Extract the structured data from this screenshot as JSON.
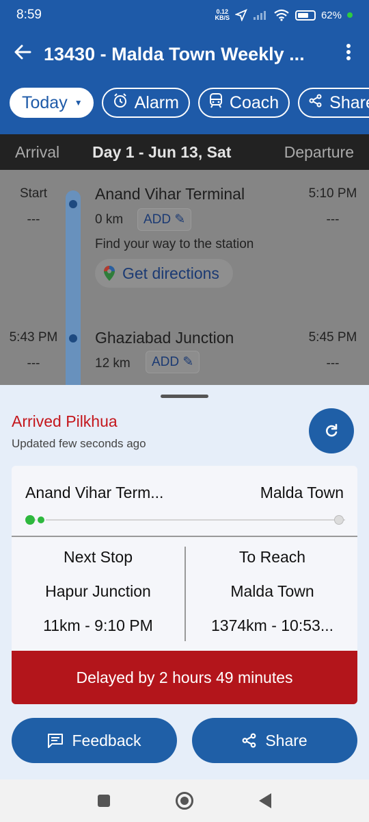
{
  "status_bar": {
    "time": "8:59",
    "net_speed_top": "0.12",
    "net_speed_bottom": "KB/S",
    "battery": "62%"
  },
  "appbar": {
    "title": "13430 - Malda Town Weekly ..."
  },
  "chips": {
    "today": "Today",
    "alarm": "Alarm",
    "coach": "Coach",
    "share": "Share"
  },
  "day_header": {
    "arrival": "Arrival",
    "day": "Day 1 - Jun 13, Sat",
    "departure": "Departure"
  },
  "stops": [
    {
      "arr_time": "Start",
      "arr_delay": "---",
      "name": "Anand Vihar Terminal",
      "km": "0 km",
      "add": "ADD",
      "dep_time": "5:10 PM",
      "dep_delay": "---",
      "find_way": "Find your way to the station",
      "directions": "Get directions"
    },
    {
      "arr_time": "5:43 PM",
      "arr_delay": "---",
      "name": "Ghaziabad Junction",
      "km": "12 km",
      "add": "ADD",
      "dep_time": "5:45 PM",
      "dep_delay": "---"
    }
  ],
  "sheet": {
    "status": "Arrived Pilkhua",
    "updated": "Updated few seconds ago",
    "from": "Anand Vihar Term...",
    "to": "Malda Town",
    "progress": 0.04,
    "next_stop": {
      "heading": "Next Stop",
      "station": "Hapur Junction",
      "info": "11km - 9:10 PM"
    },
    "to_reach": {
      "heading": "To Reach",
      "station": "Malda Town",
      "info": "1374km - 10:53..."
    },
    "delay": "Delayed by 2 hours 49 minutes",
    "feedback": "Feedback",
    "share": "Share"
  },
  "colors": {
    "primary": "#1e5aa8",
    "delay_red": "#b3151b",
    "status_red": "#c4161c",
    "progress_green": "#2eb83e"
  }
}
